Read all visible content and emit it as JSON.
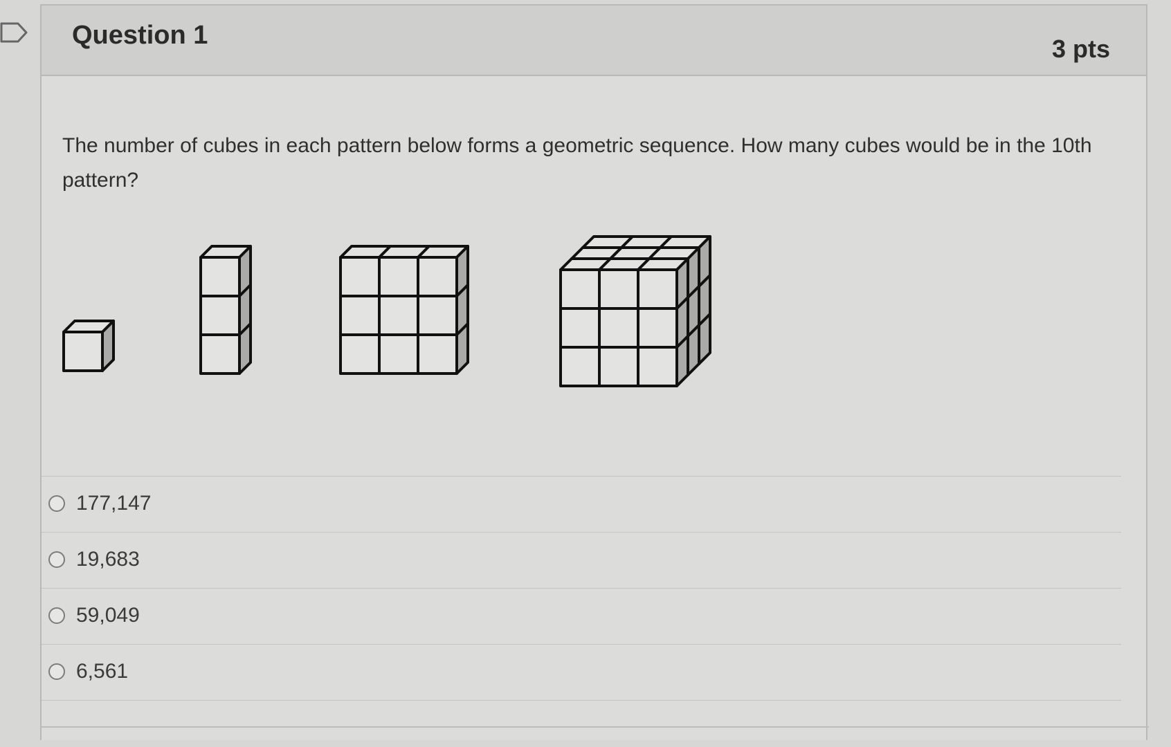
{
  "question": {
    "title": "Question 1",
    "points": "3 pts",
    "text": "The number of cubes in each pattern below forms a geometric sequence. How many cubes would be in the 10th pattern?"
  },
  "figure": {
    "patterns": [
      {
        "cols": 1,
        "rows": 1,
        "depth": 1
      },
      {
        "cols": 1,
        "rows": 3,
        "depth": 1
      },
      {
        "cols": 3,
        "rows": 3,
        "depth": 1
      },
      {
        "cols": 3,
        "rows": 3,
        "depth": 3
      }
    ]
  },
  "answers": [
    {
      "label": "177,147"
    },
    {
      "label": "19,683"
    },
    {
      "label": "59,049"
    },
    {
      "label": "6,561"
    }
  ],
  "colors": {
    "page_bg": "#d7d7d5",
    "header_bg": "#cfcfcd",
    "cube_face": "#e3e3e1",
    "cube_side": "#aaaaa8",
    "stroke": "#111111"
  }
}
